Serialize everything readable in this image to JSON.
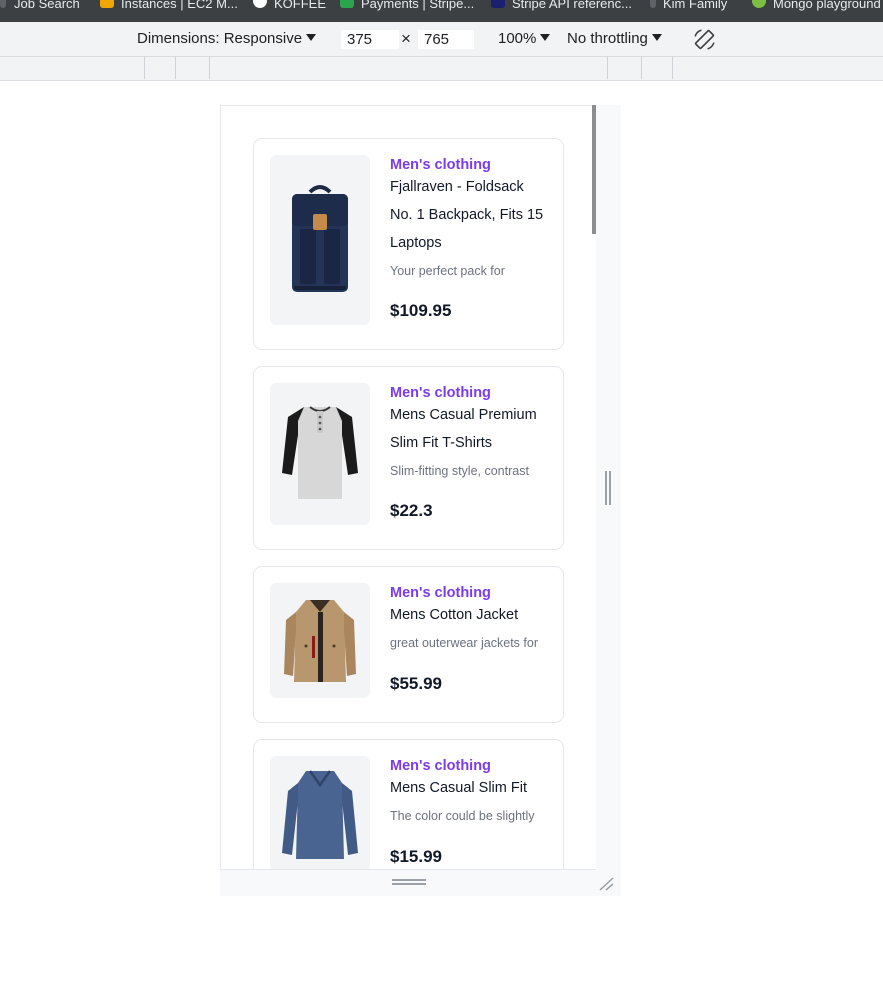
{
  "bookmarks": [
    {
      "label": "Job Search",
      "icon": "bookmark-icon",
      "color": "#3c4043"
    },
    {
      "label": "Instances | EC2 M...",
      "icon": "aws-icon",
      "color": "#f0a800"
    },
    {
      "label": "KOFFEE",
      "icon": "koffee-icon",
      "color": "#ffffff"
    },
    {
      "label": "Payments | Stripe...",
      "icon": "stripe-s-icon",
      "color": "#2ca44e"
    },
    {
      "label": "Stripe API referenc...",
      "icon": "stripe-api-icon",
      "color": "#1a1f71"
    },
    {
      "label": "Kim Family",
      "icon": "folder-icon",
      "color": "#3c4043"
    },
    {
      "label": "Mongo playground",
      "icon": "mongo-icon",
      "color": "#7bc043"
    }
  ],
  "toolbar": {
    "dimensions_label": "Dimensions: Responsive",
    "width": "375",
    "times": "×",
    "height": "765",
    "zoom": "100%",
    "throttling": "No throttling"
  },
  "products": [
    {
      "category": "Men's clothing",
      "title_lines": [
        "Fjallraven - Foldsack",
        "No. 1 Backpack, Fits 15",
        "Laptops"
      ],
      "description": "Your perfect pack for",
      "price": "$109.95",
      "image": "backpack-icon"
    },
    {
      "category": "Men's clothing",
      "title_lines": [
        "Mens Casual Premium",
        "Slim Fit T-Shirts"
      ],
      "description": "Slim-fitting style, contrast",
      "price": "$22.3",
      "image": "raglan-shirt-icon"
    },
    {
      "category": "Men's clothing",
      "title_lines": [
        "Mens Cotton Jacket"
      ],
      "description": "great outerwear jackets for",
      "price": "$55.99",
      "image": "jacket-icon"
    },
    {
      "category": "Men's clothing",
      "title_lines": [
        "Mens Casual Slim Fit"
      ],
      "description": "The color could be slightly",
      "price": "$15.99",
      "image": "long-sleeve-shirt-icon"
    }
  ]
}
